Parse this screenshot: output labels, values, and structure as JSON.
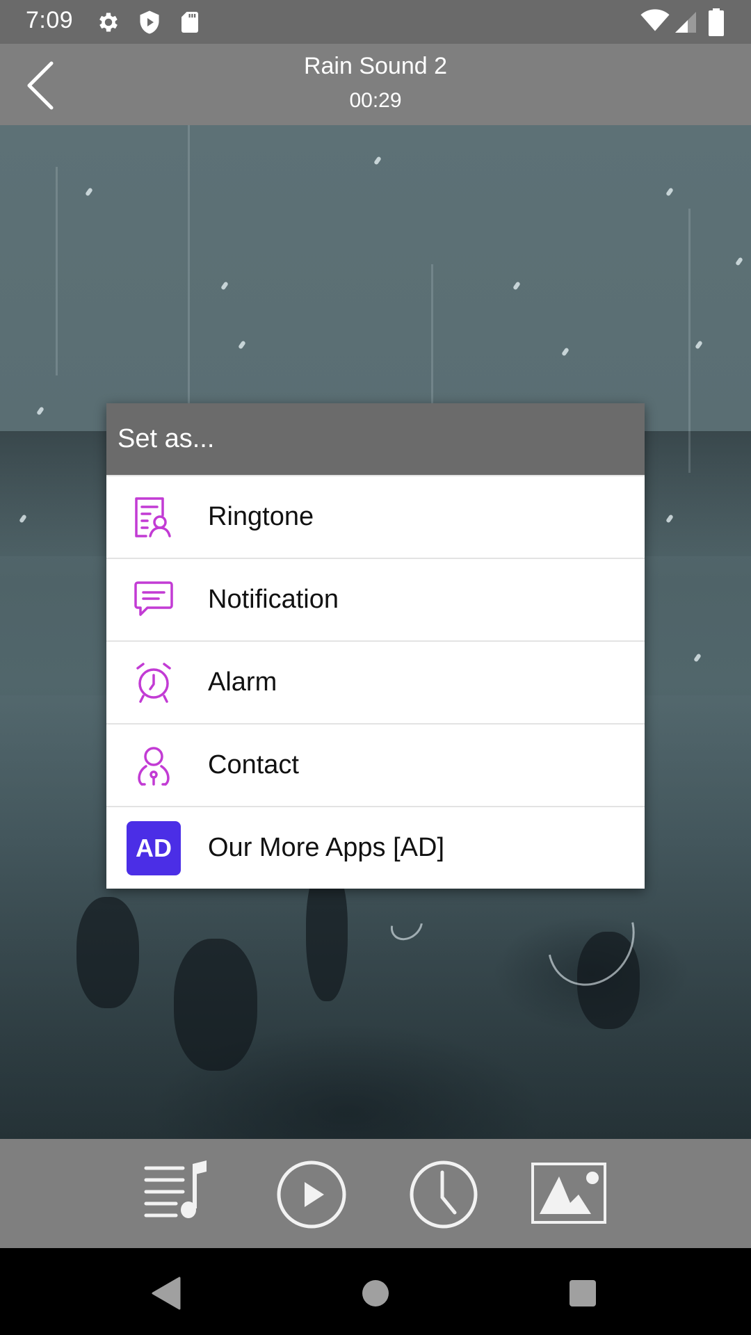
{
  "status_bar": {
    "time": "7:09",
    "left_icons": [
      "gear-icon",
      "shield-play-icon",
      "sd-card-icon"
    ],
    "right_icons": [
      "wifi-icon",
      "signal-icon",
      "battery-icon"
    ]
  },
  "app_bar": {
    "back_icon": "chevron-left-icon",
    "title": "Rain Sound 2",
    "subtitle": "00:29"
  },
  "dialog": {
    "title": "Set as...",
    "accent_color": "#c23bd4",
    "items": [
      {
        "label": "Ringtone",
        "icon": "ringtone-icon"
      },
      {
        "label": "Notification",
        "icon": "notification-icon"
      },
      {
        "label": "Alarm",
        "icon": "alarm-clock-icon"
      },
      {
        "label": "Contact",
        "icon": "contact-icon"
      },
      {
        "label": "Our More Apps [AD]",
        "icon": "ad-icon",
        "badge_text": "AD",
        "badge_color": "#4b2ee6"
      }
    ]
  },
  "bottom_toolbar": {
    "buttons": [
      {
        "name": "playlist",
        "icon": "playlist-music-icon"
      },
      {
        "name": "play",
        "icon": "play-circle-icon"
      },
      {
        "name": "timer",
        "icon": "clock-icon"
      },
      {
        "name": "wallpaper",
        "icon": "image-icon"
      }
    ]
  },
  "nav_bar": {
    "buttons": [
      "back-triangle-icon",
      "home-circle-icon",
      "recents-square-icon"
    ]
  }
}
